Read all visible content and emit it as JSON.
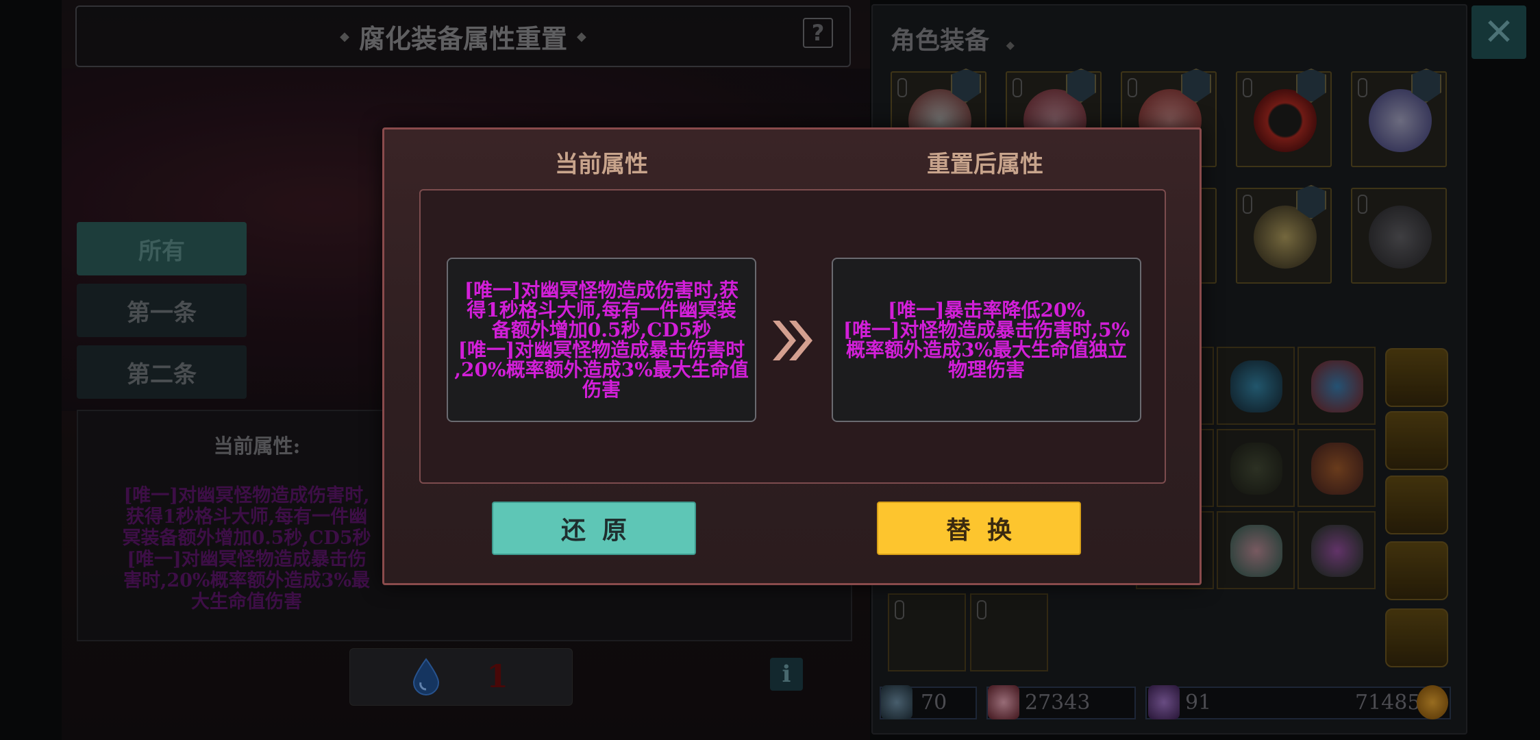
{
  "left": {
    "title": "腐化装备属性重置",
    "filters": [
      "所有",
      "第一条",
      "第二条"
    ],
    "current_label": "当前属性:",
    "current_lines": [
      "[唯一]对幽冥怪物造成伤害时,",
      "获得1秒格斗大师,每有一件幽",
      "冥装备额外增加0.5秒,CD5秒",
      "[唯一]对幽冥怪物造成暴击伤",
      "害时,20%概率额外造成3%最",
      "大生命值伤害"
    ],
    "cost_value": "1"
  },
  "right": {
    "title": "角色装备",
    "stats": {
      "power": "70",
      "hp": "27343",
      "crystal": "91",
      "gold": "71485"
    }
  },
  "modal": {
    "current_title": "当前属性",
    "after_title": "重置后属性",
    "current_lines": [
      "[唯一]对幽冥怪物造成伤害时,获",
      "得1秒格斗大师,每有一件幽冥装",
      "备额外增加0.5秒,CD5秒",
      "[唯一]对幽冥怪物造成暴击伤害时",
      ",20%概率额外造成3%最大生命值",
      "伤害"
    ],
    "after_lines": [
      "[唯一]暴击率降低20%",
      "[唯一]对怪物造成暴击伤害时,5%",
      "概率额外造成3%最大生命值独立",
      "物理伤害"
    ],
    "restore_label": "还原",
    "replace_label": "替换"
  },
  "colors": {
    "attribute_text": "#d21fd8",
    "restore_button": "#5ec6b6",
    "replace_button": "#fdc52e",
    "modal_border": "#8a4b4c"
  }
}
